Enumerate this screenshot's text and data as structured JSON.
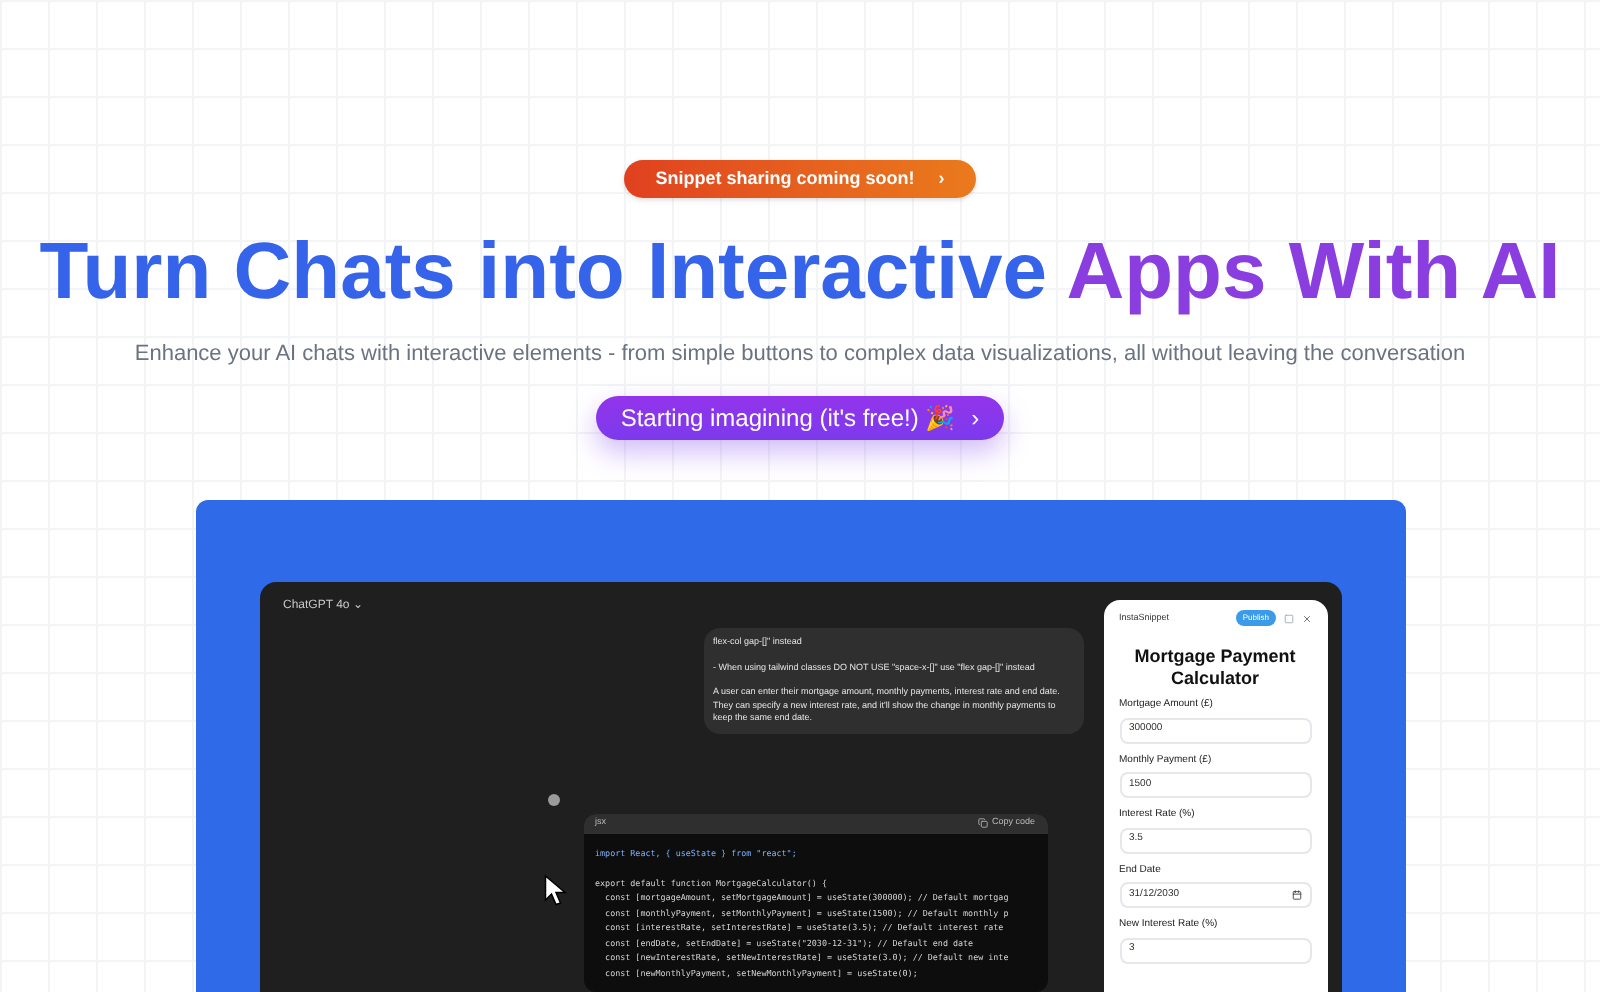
{
  "announcement": {
    "text": "Snippet sharing coming soon!",
    "arrow": "›"
  },
  "hero": {
    "title_start": "Turn Chats into Interactive",
    "title_end": "Apps With AI",
    "subtitle": "Enhance your AI chats with interactive elements - from simple buttons to complex data visualizations, all without leaving the conversation"
  },
  "cta": {
    "label": "Starting imagining (it's free!) 🎉",
    "arrow": "›"
  },
  "preview": {
    "model": "ChatGPT 4o ⌄",
    "message": [
      "flex-col gap-[]\" instead",
      "- When using tailwind classes DO NOT USE \"space-x-[]\" use \"flex gap-[]\" instead",
      "A user can enter their mortgage amount, monthly payments, interest rate and end date. They can specify a new interest rate, and it'll show the change in monthly payments to keep the same end date."
    ],
    "code": {
      "language": "jsx",
      "copy": "Copy code",
      "lines": [
        "import React, { useState } from \"react\";",
        "export default function MortgageCalculator() {",
        "  const [mortgageAmount, setMortgageAmount] = useState(300000); // Default mortgag",
        "  const [monthlyPayment, setMonthlyPayment] = useState(1500); // Default monthly p",
        "  const [interestRate, setInterestRate] = useState(3.5); // Default interest rate",
        "  const [endDate, setEndDate] = useState(\"2030-12-31\"); // Default end date",
        "  const [newInterestRate, setNewInterestRate] = useState(3.0); // Default new inte",
        "  const [newMonthlyPayment, setNewMonthlyPayment] = useState(0);"
      ]
    },
    "snippet": {
      "app": "InstaSnippet",
      "publish": "Publish",
      "title": "Mortgage Payment Calculator",
      "fields": [
        {
          "label": "Mortgage Amount (£)",
          "value": "300000",
          "kind": "text"
        },
        {
          "label": "Monthly Payment (£)",
          "value": "1500",
          "kind": "text"
        },
        {
          "label": "Interest Rate (%)",
          "value": "3.5",
          "kind": "text"
        },
        {
          "label": "End Date",
          "value": "31/12/2030",
          "kind": "date"
        },
        {
          "label": "New Interest Rate (%)",
          "value": "3",
          "kind": "text"
        }
      ]
    }
  }
}
